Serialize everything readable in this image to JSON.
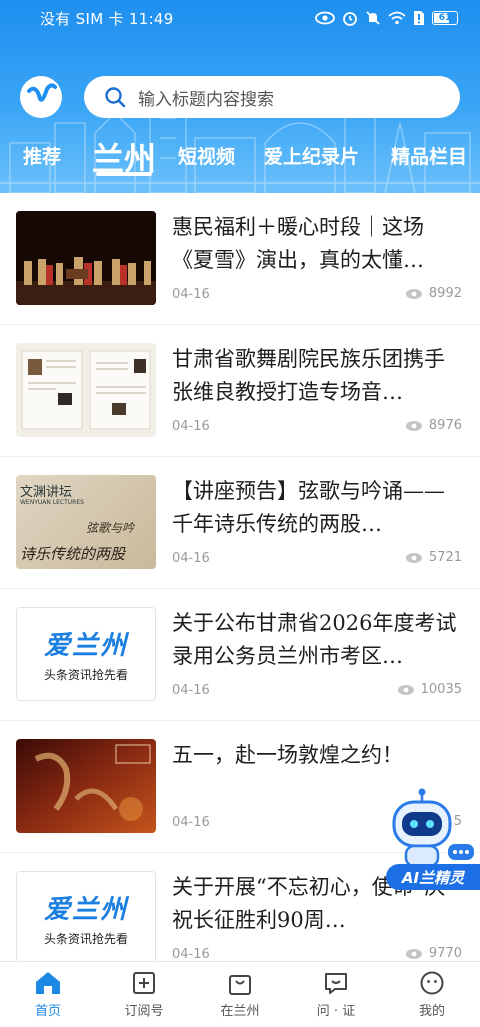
{
  "status_bar": {
    "left_text": "没有 SIM 卡 11:49",
    "battery": "61"
  },
  "search": {
    "placeholder": "输入标题内容搜索"
  },
  "tabs": [
    "推荐",
    "兰州",
    "短视频",
    "爱上纪录片",
    "精品栏目"
  ],
  "active_tab": "兰州",
  "articles": [
    {
      "title": "惠民福利＋暖心时段｜这场《夏雪》演出，真的太懂…",
      "date": "04-16",
      "views": "8992",
      "thumb": "stage-photo"
    },
    {
      "title": "甘肃省歌舞剧院民族乐团携手张维良教授打造专场音…",
      "date": "04-16",
      "views": "8976",
      "thumb": "poster-photo"
    },
    {
      "title": "【讲座预告】弦歌与吟诵——千年诗乐传统的两股…",
      "date": "04-16",
      "views": "5721",
      "thumb": "lecture-poster",
      "thumb_text": {
        "top": "文渊讲坛",
        "sub": "WENYUAN LECTURES",
        "line1": "弦歌与吟",
        "line2": "诗乐传统的两股"
      }
    },
    {
      "title": "关于公布甘肃省2026年度考试录用公务员兰州市考区…",
      "date": "04-16",
      "views": "10035",
      "thumb": "brand-logo",
      "thumb_text": {
        "main": "爱兰州",
        "sub": "头条资讯抢先看"
      }
    },
    {
      "title": "五一，赴一场敦煌之约！",
      "date": "04-16",
      "views": "5",
      "thumb": "dunhuang-poster"
    },
    {
      "title": "关于开展“不忘初心，使命”庆祝长征胜利90周…",
      "date": "04-16",
      "views": "9770",
      "thumb": "brand-logo",
      "thumb_text": {
        "main": "爱兰州",
        "sub": "头条资讯抢先看"
      }
    }
  ],
  "ai_assistant": {
    "label": "AI兰精灵"
  },
  "bottom_nav": [
    {
      "label": "首页",
      "icon": "home-icon",
      "active": true
    },
    {
      "label": "订阅号",
      "icon": "subscribe-icon",
      "active": false
    },
    {
      "label": "在兰州",
      "icon": "bag-icon",
      "active": false
    },
    {
      "label": "问 · 证",
      "icon": "chat-icon",
      "active": false
    },
    {
      "label": "我的",
      "icon": "profile-icon",
      "active": false
    }
  ],
  "colors": {
    "header_top": "#1e8ff0",
    "accent": "#1e88e5",
    "ai_badge": "#1d6fe6"
  }
}
